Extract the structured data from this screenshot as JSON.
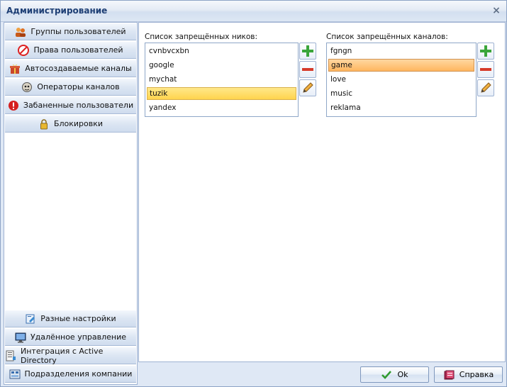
{
  "window": {
    "title": "Администрирование",
    "close_icon_glyph": "×"
  },
  "sidebar": {
    "items_top": [
      {
        "label": "Группы пользователей",
        "icon": "users-group-icon"
      },
      {
        "label": "Права пользователей",
        "icon": "no-entry-icon"
      },
      {
        "label": "Автосоздаваемые каналы",
        "icon": "gift-box-icon"
      },
      {
        "label": "Операторы каналов",
        "icon": "operator-face-icon"
      },
      {
        "label": "Забаненные пользователи",
        "icon": "banned-alert-icon"
      },
      {
        "label": "Блокировки",
        "icon": "lock-icon"
      }
    ],
    "items_bottom": [
      {
        "label": "Разные настройки",
        "icon": "settings-icon"
      },
      {
        "label": "Удалённое управление",
        "icon": "monitor-icon"
      },
      {
        "label": "Интеграция с Active Directory",
        "icon": "directory-icon"
      },
      {
        "label": "Подразделения компании",
        "icon": "company-icon"
      }
    ]
  },
  "main": {
    "nicks": {
      "label": "Список запрещённых ников:",
      "items": [
        "cvnbvcxbn",
        "google",
        "mychat",
        "tuzik",
        "yandex"
      ],
      "selected": "tuzik"
    },
    "channels": {
      "label": "Список запрещённых каналов:",
      "items": [
        "fgngn",
        "game",
        "love",
        "music",
        "reklama"
      ],
      "selected": "game"
    }
  },
  "footer": {
    "ok_label": "Ok",
    "help_label": "Справка"
  },
  "colors": {
    "title_text": "#1e3f75",
    "selection_yellow": "#ffd44d",
    "selection_orange": "#ffb65f",
    "add_green": "#3aa53a",
    "remove_red": "#d63a2a"
  }
}
